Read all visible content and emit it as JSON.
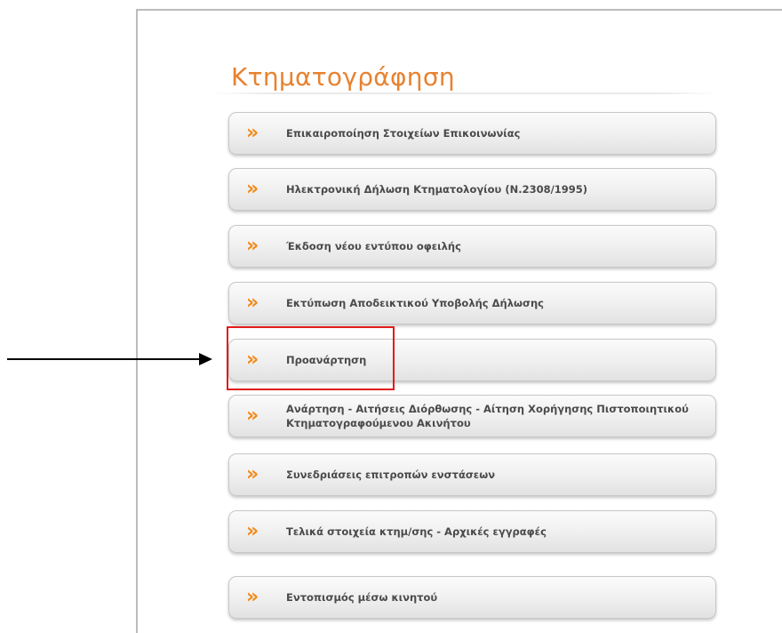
{
  "page": {
    "title": "Κτηματογράφηση"
  },
  "menu": {
    "chevron_glyph": "»",
    "chevron_icon": "double-chevron-right-icon",
    "accent_color": "#ef8a1c",
    "items": [
      {
        "label": "Επικαιροποίηση Στοιχείων Επικοινωνίας"
      },
      {
        "label": "Ηλεκτρονική Δήλωση Κτηματολογίου (Ν.2308/1995)"
      },
      {
        "label": "Έκδοση νέου εντύπου οφειλής"
      },
      {
        "label": "Εκτύπωση Αποδεικτικού Υποβολής Δήλωσης"
      },
      {
        "label": "Προανάρτηση"
      },
      {
        "label": "Ανάρτηση - Αιτήσεις Διόρθωσης - Αίτηση Χορήγησης Πιστοποιητικού Κτηματογραφούμενου Ακινήτου"
      },
      {
        "label": "Συνεδριάσεις επιτροπών ενστάσεων"
      },
      {
        "label": "Τελικά στοιχεία κτημ/σης - Αρχικές εγγραφές"
      },
      {
        "label": "Εντοπισμός μέσω κινητού"
      }
    ]
  },
  "annotation": {
    "highlight_color": "#e21c1c",
    "arrow_color": "#000000"
  }
}
